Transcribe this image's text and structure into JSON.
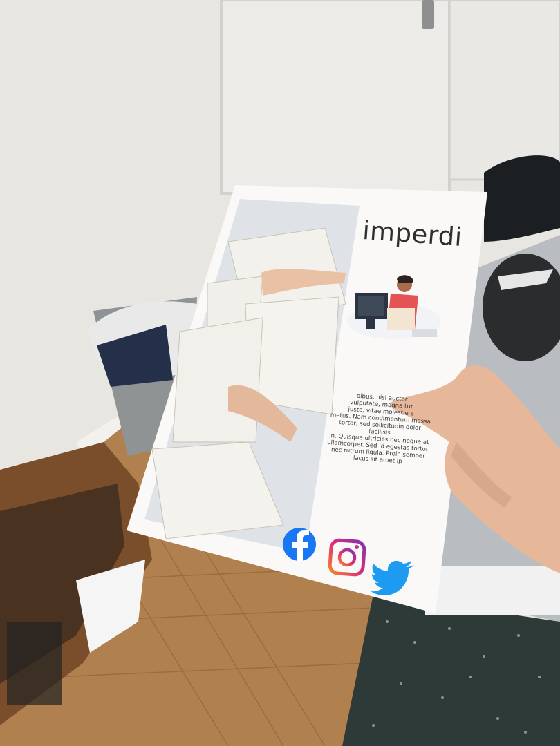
{
  "flyer": {
    "title": "imperdi",
    "body_lines": [
      "pibus, nisi auctor",
      "vulputate, magna tur",
      "justo, vitae molestie e",
      "metus. Nam condimentum massa",
      "tortor, sed sollicitudin dolor facilisis",
      "in. Quisque ultricies nec neque at",
      "ullamcorper. Sed id egestas tortor,",
      "nec rutrum ligula. Proin semper",
      "lacus sit amet ip"
    ],
    "social_icons": [
      "facebook-icon",
      "instagram-icon",
      "twitter-icon"
    ]
  },
  "colors": {
    "facebook": "#1877f2",
    "instagram_start": "#f58529",
    "instagram_end": "#8134af",
    "twitter": "#1d9bf0",
    "paper": "#faf9f7",
    "floor": "#a87a4d",
    "rug": "#2f3a38"
  }
}
